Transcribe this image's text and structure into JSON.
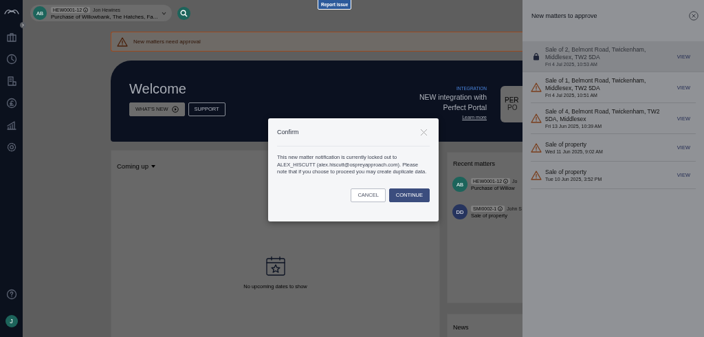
{
  "report_issue": {
    "label": "Report issue"
  },
  "sidebar": {
    "avatar": "J"
  },
  "matter_selector": {
    "avatar": "AB",
    "color": "#1d645b",
    "reference": "HEW0001-12",
    "owner": "Jon Hewines",
    "title": "Purchase of Willowbank, The Hatches, Fa..."
  },
  "alert": {
    "text": "New matters need approval"
  },
  "welcome": {
    "title": "Welcome",
    "buttons": [
      {
        "label": "WHAT'S NEW",
        "kind": "filled"
      },
      {
        "label": "SUPPORT",
        "kind": "outline"
      }
    ],
    "promo": {
      "tag": "INTEGRATION",
      "headline": "NEW integration with Perfect Portal",
      "link": "Learn more",
      "logo_lines": [
        "PER",
        "PO"
      ]
    }
  },
  "coming_up": {
    "title": "Coming up",
    "empty_text": "No upcoming dates to show"
  },
  "recent_matters": {
    "title": "Recent matters",
    "items": [
      {
        "avatar": "AB",
        "color": "#1d645b",
        "reference": "HEW0001-12",
        "owner": "Jo",
        "title": "Purchase of Willow"
      },
      {
        "avatar": "DD",
        "color": "#26345e",
        "reference": "SMI0002-1",
        "owner": "John S",
        "title": "Sale of property"
      }
    ]
  },
  "news": {
    "title": "News"
  },
  "drawer": {
    "title": "New matters to approve",
    "items": [
      {
        "locked": true,
        "title": "Sale of 2, Belmont Road, Twickenham, Middlesex, TW2 5DA",
        "date": "Fri 4 Jul 2025, 10:53 AM",
        "action": "VIEW"
      },
      {
        "locked": false,
        "title": "Sale of 1, Belmont Road, Twickenham, Middlesex, TW2 5DA",
        "date": "Fri 4 Jul 2025, 10:51 AM",
        "action": "VIEW"
      },
      {
        "locked": false,
        "title": "Sale of 4, Belmont Road, Twickenham, TW2 5DA, Middlesex",
        "date": "Fri 13 Jun 2025, 10:39 AM",
        "action": "VIEW"
      },
      {
        "locked": false,
        "title": "Sale of property",
        "date": "Wed 11 Jun 2025, 9:02 AM",
        "action": "VIEW"
      },
      {
        "locked": false,
        "title": "Sale of property",
        "date": "Tue 10 Jun 2025, 3:52 PM",
        "action": "VIEW"
      }
    ]
  },
  "modal": {
    "title": "Confirm",
    "message": "This new matter notification is currently locked out to ALEX_HISCUTT (alex.hiscutt@ospreyapproach.com). Please note that if you choose to proceed you may create duplicate data.",
    "buttons": [
      {
        "label": "CANCEL",
        "kind": "secondary"
      },
      {
        "label": "CONTINUE",
        "kind": "primary"
      }
    ]
  }
}
